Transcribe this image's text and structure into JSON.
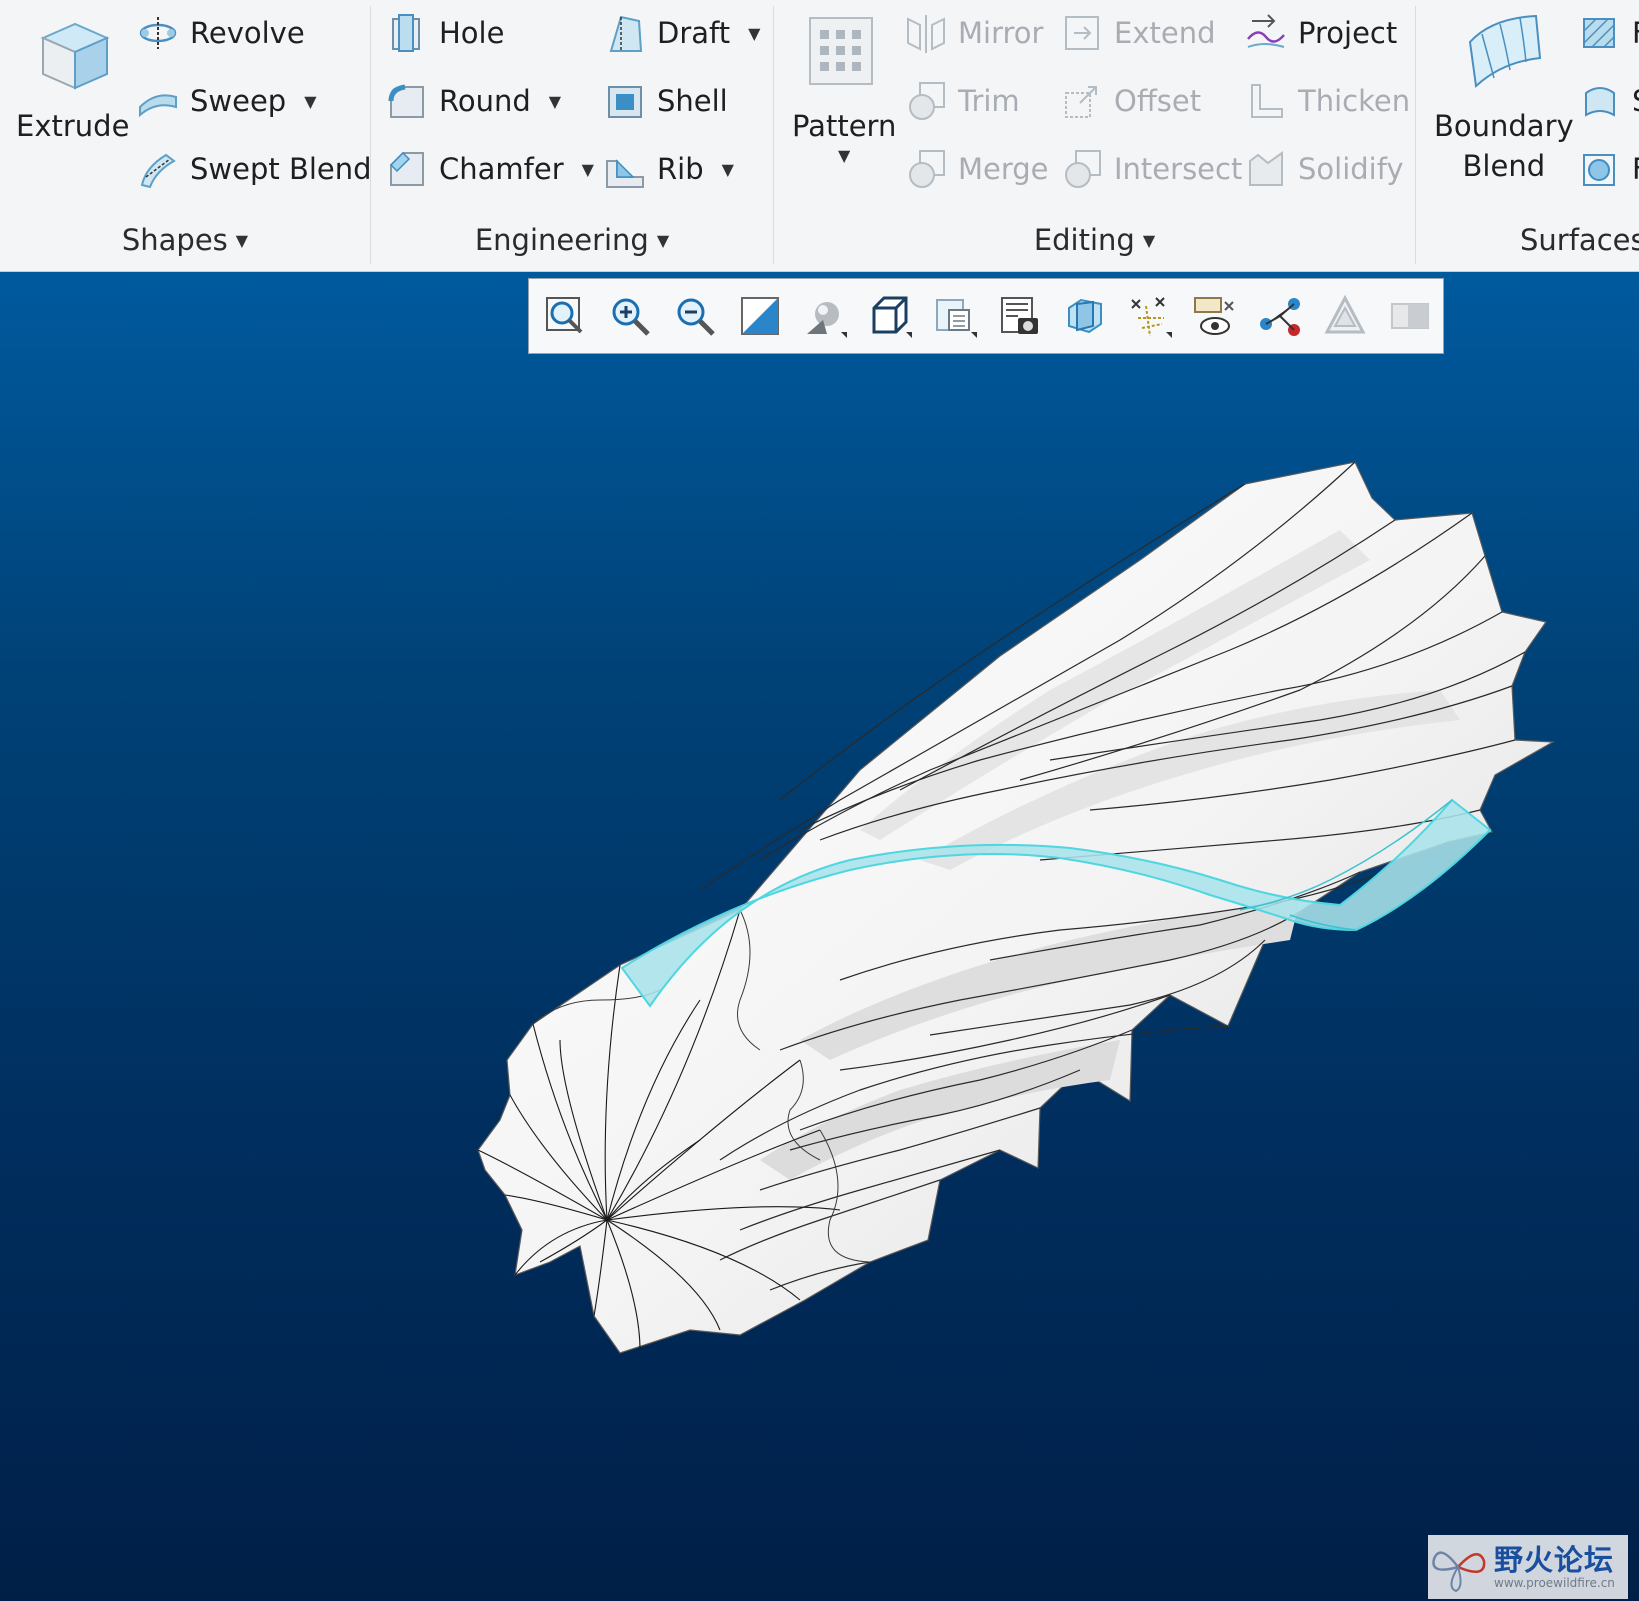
{
  "ribbon": {
    "shapes": {
      "label": "Shapes",
      "extrude": "Extrude",
      "revolve": "Revolve",
      "sweep": "Sweep",
      "swept_blend": "Swept Blend"
    },
    "engineering": {
      "label": "Engineering",
      "hole": "Hole",
      "round": "Round",
      "chamfer": "Chamfer",
      "draft": "Draft",
      "shell": "Shell",
      "rib": "Rib"
    },
    "editing": {
      "label": "Editing",
      "pattern": "Pattern",
      "mirror": "Mirror",
      "trim": "Trim",
      "merge": "Merge",
      "extend": "Extend",
      "offset": "Offset",
      "intersect": "Intersect",
      "project": "Project",
      "thicken": "Thicken",
      "solidify": "Solidify"
    },
    "surfaces": {
      "label": "Surfaces",
      "boundary_blend_1": "Boundary",
      "boundary_blend_2": "Blend",
      "cut_1": "F",
      "cut_2": "S",
      "cut_3": "F"
    },
    "dropdown_glyph": "▼"
  },
  "view_toolbar": {
    "icons": [
      "refit-icon",
      "zoom-in-icon",
      "zoom-out-icon",
      "repaint-icon",
      "display-style-icon",
      "saved-orientations-icon",
      "named-views-icon",
      "view-manager-icon",
      "section-icon",
      "datum-display-icon",
      "annotation-display-icon",
      "spin-center-icon",
      "triangle-tool-icon",
      "shade-tool-icon"
    ]
  },
  "watermark": {
    "chinese": "野火论坛",
    "url": "www.proewildfire.cn"
  },
  "colors": {
    "viewport_top": "#005a9e",
    "viewport_bottom": "#001f47",
    "highlight": "#4fd6e0",
    "ribbon_bg": "#f4f5f7"
  }
}
